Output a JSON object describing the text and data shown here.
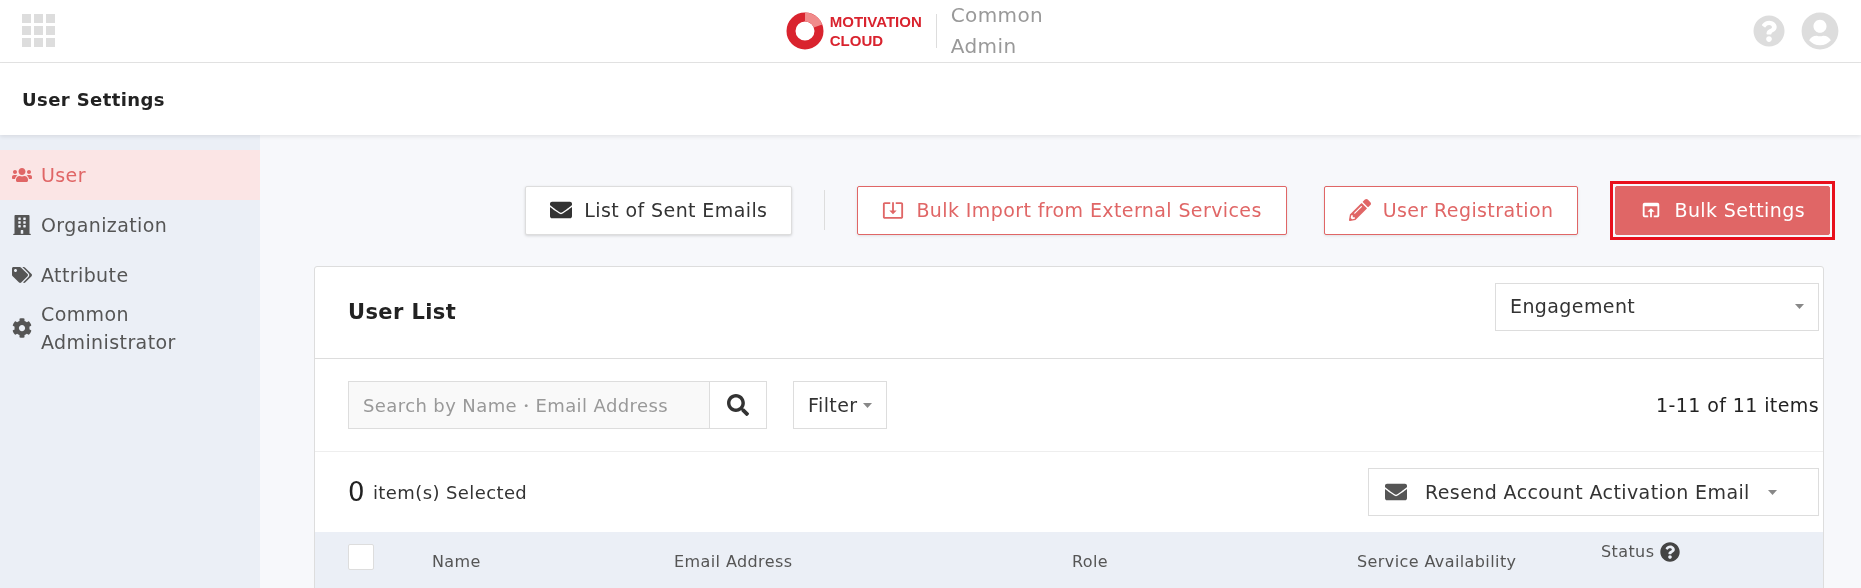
{
  "header": {
    "logo_line1": "MOTIVATION",
    "logo_line2": "CLOUD",
    "product_line1": "Common",
    "product_line2": "Admin"
  },
  "page_title": "User Settings",
  "sidebar": {
    "items": [
      {
        "label": "User",
        "selected": true
      },
      {
        "label": "Organization",
        "selected": false
      },
      {
        "label": "Attribute",
        "selected": false
      },
      {
        "label": "Common Administrator",
        "selected": false
      }
    ]
  },
  "actions": [
    {
      "label": "List of Sent Emails",
      "kind": "plain",
      "highlighted": false
    },
    {
      "label": "Bulk Import from External Services",
      "kind": "outline",
      "highlighted": false
    },
    {
      "label": "User Registration",
      "kind": "outline",
      "highlighted": false
    },
    {
      "label": "Bulk Settings",
      "kind": "primary",
      "highlighted": true
    }
  ],
  "user_list": {
    "title": "User List",
    "service_select": "Engagement",
    "search": {
      "placeholder": "Search by Name・Email Address"
    },
    "filter": "Filter",
    "count": "1-11 of 11 items",
    "selected_count": "0",
    "selected_label": "item(s) Selected",
    "bulk_action": "Resend Account Activation Email",
    "columns": [
      {
        "label": "Name",
        "help": false
      },
      {
        "label": "Email Address",
        "help": false
      },
      {
        "label": "Role",
        "help": false
      },
      {
        "label": "Service Availability",
        "help": false
      },
      {
        "label": "Status",
        "help": true
      }
    ],
    "select_all_checked": false
  }
}
